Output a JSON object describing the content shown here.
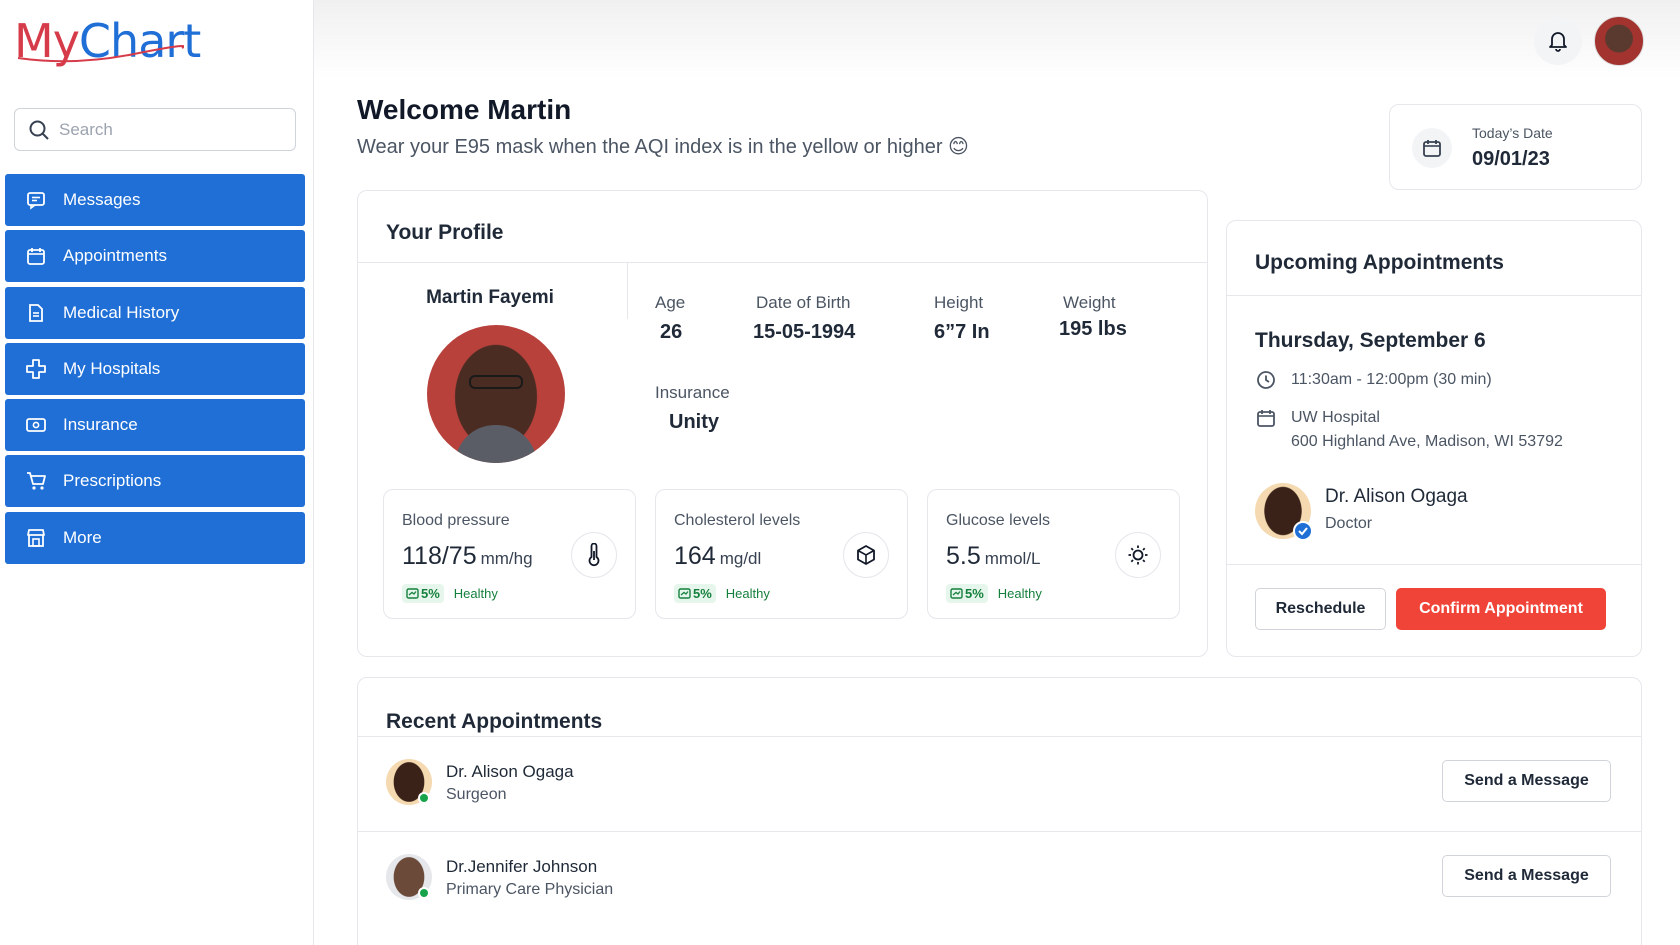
{
  "brand": {
    "name_part1": "My",
    "name_part2": "Chart",
    "color_primary": "#1f6fd6",
    "color_accent": "#d63b4a"
  },
  "search": {
    "placeholder": "Search"
  },
  "nav": {
    "items": [
      {
        "label": "Messages",
        "icon": "message-icon"
      },
      {
        "label": "Appointments",
        "icon": "calendar-icon"
      },
      {
        "label": "Medical History",
        "icon": "document-icon"
      },
      {
        "label": "My Hospitals",
        "icon": "cross-icon"
      },
      {
        "label": "Insurance",
        "icon": "card-icon"
      },
      {
        "label": "Prescriptions",
        "icon": "cart-icon"
      },
      {
        "label": "More",
        "icon": "store-icon"
      }
    ]
  },
  "header": {
    "welcome": "Welcome Martin",
    "subtitle": "Wear your E95 mask when the AQI index is in the yellow or higher 😊"
  },
  "date": {
    "label": "Today’s Date",
    "value": "09/01/23"
  },
  "profile": {
    "title": "Your Profile",
    "name": "Martin Fayemi",
    "age_label": "Age",
    "age": "26",
    "dob_label": "Date of Birth",
    "dob": "15-05-1994",
    "height_label": "Height",
    "height": "6”7 In",
    "weight_label": "Weight",
    "weight": "195 lbs",
    "insurance_label": "Insurance",
    "insurance": "Unity"
  },
  "metrics": [
    {
      "label": "Blood pressure",
      "value": "118/75",
      "unit": "mm/hg",
      "change": "5%",
      "status": "Healthy",
      "icon": "thermometer-icon"
    },
    {
      "label": "Cholesterol levels",
      "value": "164",
      "unit": "mg/dl",
      "change": "5%",
      "status": "Healthy",
      "icon": "cube-icon"
    },
    {
      "label": "Glucose levels",
      "value": "5.5",
      "unit": "mmol/L",
      "change": "5%",
      "status": "Healthy",
      "icon": "sun-icon"
    }
  ],
  "upcoming": {
    "title": "Upcoming Appointments",
    "day": "Thursday, September 6",
    "time": "11:30am - 12:00pm (30 min)",
    "location_name": "UW Hospital",
    "location_address": "600 Highland Ave, Madison, WI 53792",
    "doctor_name": "Dr. Alison Ogaga",
    "doctor_role": "Doctor",
    "reschedule_label": "Reschedule",
    "confirm_label": "Confirm Appointment"
  },
  "recent": {
    "title": "Recent Appointments",
    "rows": [
      {
        "name": "Dr. Alison Ogaga",
        "role": "Surgeon",
        "button": "Send a Message"
      },
      {
        "name": "Dr.Jennifer Johnson",
        "role": "Primary Care Physician",
        "button": "Send a Message"
      }
    ]
  }
}
